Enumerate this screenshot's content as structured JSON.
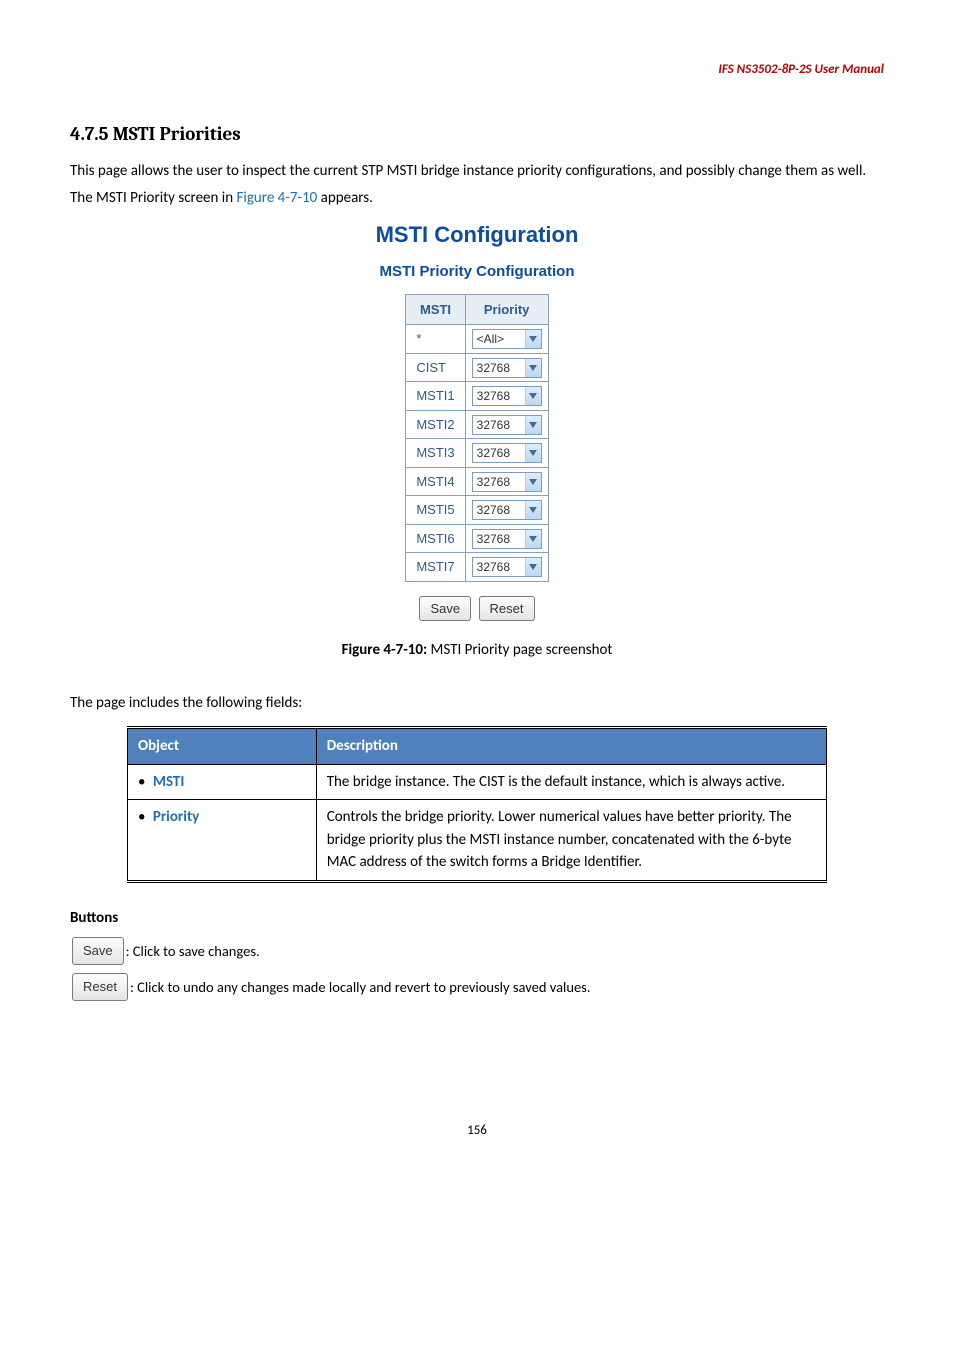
{
  "header": {
    "text": "IFS  NS3502-8P-2S   User   Manual"
  },
  "section": {
    "title": "4.7.5 MSTI Priorities",
    "intro_prefix": "This page allows the user to inspect the current STP MSTI bridge instance priority configurations, and possibly change them as well. The MSTI Priority screen in ",
    "fig_ref": "Figure 4-7-10",
    "intro_suffix": " appears."
  },
  "config": {
    "title": "MSTI Configuration",
    "subtitle": "MSTI Priority Configuration",
    "columns": {
      "msti": "MSTI",
      "priority": "Priority"
    },
    "rows": [
      {
        "msti": "*",
        "priority": "<All>"
      },
      {
        "msti": "CIST",
        "priority": "32768"
      },
      {
        "msti": "MSTI1",
        "priority": "32768"
      },
      {
        "msti": "MSTI2",
        "priority": "32768"
      },
      {
        "msti": "MSTI3",
        "priority": "32768"
      },
      {
        "msti": "MSTI4",
        "priority": "32768"
      },
      {
        "msti": "MSTI5",
        "priority": "32768"
      },
      {
        "msti": "MSTI6",
        "priority": "32768"
      },
      {
        "msti": "MSTI7",
        "priority": "32768"
      }
    ],
    "buttons": {
      "save": "Save",
      "reset": "Reset"
    }
  },
  "caption": {
    "bold": "Figure 4-7-10:",
    "rest": " MSTI Priority page screenshot"
  },
  "fields_intro": "The page includes the following fields:",
  "desc_table": {
    "headers": {
      "object": "Object",
      "description": "Description"
    },
    "rows": [
      {
        "object": "MSTI",
        "description": "The bridge instance. The CIST is the default instance, which is always active."
      },
      {
        "object": "Priority",
        "description": "Controls the bridge priority. Lower numerical values have better priority. The bridge priority plus the MSTI instance number, concatenated with the 6-byte MAC address of the switch forms a Bridge Identifier."
      }
    ]
  },
  "buttons_section": {
    "title": "Buttons",
    "save": {
      "label": "Save",
      "text": ": Click to save changes."
    },
    "reset": {
      "label": "Reset",
      "text": ": Click to undo any changes made locally and revert to previously saved values."
    }
  },
  "page_number": "156"
}
